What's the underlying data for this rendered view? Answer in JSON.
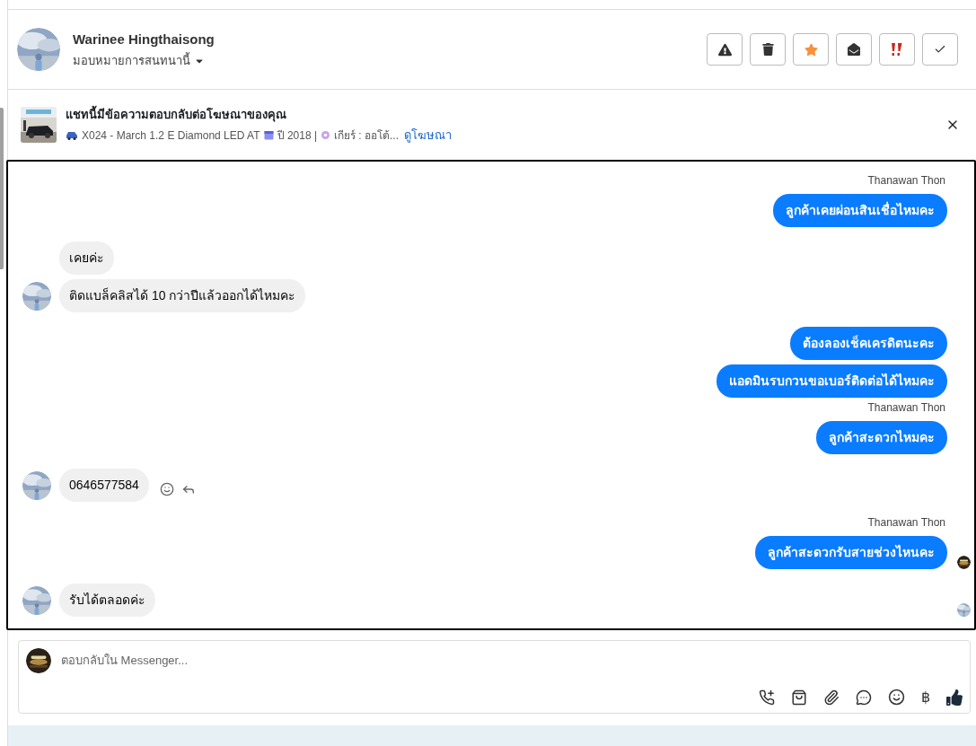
{
  "header": {
    "name": "Warinee Hingthaisong",
    "assign_label": "มอบหมายการสนทนานี้",
    "actions": [
      {
        "kind": "spam"
      },
      {
        "kind": "delete"
      },
      {
        "kind": "star"
      },
      {
        "kind": "unread"
      },
      {
        "kind": "urgent"
      },
      {
        "kind": "done"
      }
    ]
  },
  "ad_banner": {
    "title": "แชทนี้มีข้อความตอบกลับต่อโฆษณาของคุณ",
    "model": "X024 - March 1.2 E Diamond LED AT",
    "year": "ปี 2018 |",
    "gear": "เกียร์ : ออโต้...",
    "link": "ดูโฆษณา"
  },
  "messages": [
    {
      "kind": "out",
      "sender": "Thanawan Thon",
      "text": "ลูกค้าเคยผ่อนสินเชื่อไหมคะ"
    },
    {
      "kind": "in",
      "text": "เคยค่ะ",
      "avatar": false
    },
    {
      "kind": "in",
      "text": "ติดแบล็คลิสได้ 10 กว่าปีแล้วออกได้ไหมคะ",
      "avatar": true
    },
    {
      "kind": "out",
      "text": "ต้องลองเช็คเครดิตนะคะ"
    },
    {
      "kind": "out",
      "text": "แอดมินรบกวนขอเบอร์ติดต่อได้ไหมคะ"
    },
    {
      "kind": "out",
      "sender": "Thanawan Thon",
      "text": "ลูกค้าสะดวกไหมคะ"
    },
    {
      "kind": "in",
      "text": "0646577584",
      "avatar": true,
      "hover_actions": true
    },
    {
      "kind": "out",
      "sender": "Thanawan Thon",
      "text": "ลูกค้าสะดวกรับสายช่วงไหนคะ",
      "seen": true
    },
    {
      "kind": "in",
      "text": "รับได้ตลอดค่ะ",
      "avatar": true,
      "seen": true
    }
  ],
  "composer": {
    "placeholder": "ตอบกลับใน Messenger...",
    "currency_symbol": "฿"
  }
}
